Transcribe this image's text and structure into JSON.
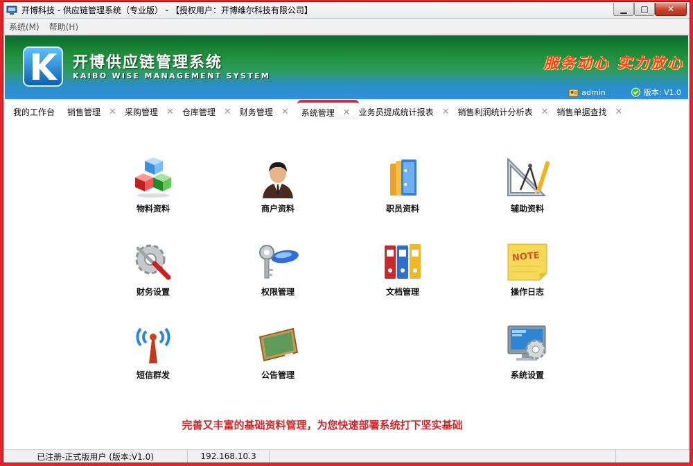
{
  "window": {
    "title": "开博科技 - 供应链管理系统（专业版） - 【授权用户：开博维尔科技有限公司】"
  },
  "menu": [
    {
      "label": "系统(M)"
    },
    {
      "label": "帮助(H)"
    }
  ],
  "banner": {
    "brand_cn": "开博供应链管理系统",
    "brand_en": "KAIBO WISE MANAGEMENT SYSTEM",
    "slogan": "服务动心 实力放心",
    "user": "admin",
    "version": "版本: V1.0"
  },
  "tabs": [
    {
      "label": "我的工作台",
      "closable": false
    },
    {
      "label": "销售管理",
      "closable": true
    },
    {
      "label": "采购管理",
      "closable": true
    },
    {
      "label": "仓库管理",
      "closable": true
    },
    {
      "label": "财务管理",
      "closable": true
    },
    {
      "label": "系统管理",
      "closable": true,
      "active": true
    },
    {
      "label": "业务员提成统计报表",
      "closable": true
    },
    {
      "label": "销售利润统计分析表",
      "closable": true
    },
    {
      "label": "销售单据查找",
      "closable": true
    }
  ],
  "modules": [
    {
      "label": "物料资料",
      "icon": "cubes-icon"
    },
    {
      "label": "商户资料",
      "icon": "businessman-icon"
    },
    {
      "label": "职员资料",
      "icon": "binders-icon"
    },
    {
      "label": "辅助资料",
      "icon": "drafting-tools-icon"
    },
    {
      "label": "财务设置",
      "icon": "gear-tools-icon"
    },
    {
      "label": "权限管理",
      "icon": "key-icon"
    },
    {
      "label": "文档管理",
      "icon": "file-folders-icon"
    },
    {
      "label": "操作日志",
      "icon": "note-icon"
    },
    {
      "label": "短信群发",
      "icon": "antenna-icon"
    },
    {
      "label": "公告管理",
      "icon": "chalkboard-icon"
    },
    {
      "label": "系统设置",
      "icon": "monitor-gear-icon"
    }
  ],
  "notice": "完善又丰富的基础资料管理，为您快速部署系统打下坚实基础",
  "status": {
    "registration": "已注册-正式版用户 (版本:V1.0)",
    "ip": "192.168.10.3"
  }
}
